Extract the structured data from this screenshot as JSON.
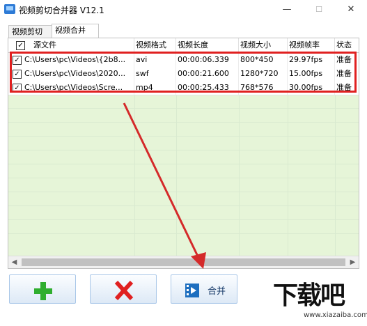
{
  "window": {
    "title": "视频剪切合并器 V12.1",
    "minimize": "—",
    "maximize": "☐",
    "close": "✕"
  },
  "tabs": [
    {
      "label": "视频剪切",
      "active": false
    },
    {
      "label": "视频合并",
      "active": true
    }
  ],
  "table": {
    "columns": [
      "源文件",
      "视频格式",
      "视频长度",
      "视频大小",
      "视频帧率",
      "状态"
    ],
    "rows": [
      {
        "checked": true,
        "file": "C:\\Users\\pc\\Videos\\{2b8...",
        "format": "avi",
        "length": "00:00:06.339",
        "size": "800*450",
        "fps": "29.97fps",
        "status": "准备"
      },
      {
        "checked": true,
        "file": "C:\\Users\\pc\\Videos\\2020...",
        "format": "swf",
        "length": "00:00:21.600",
        "size": "1280*720",
        "fps": "15.00fps",
        "status": "准备"
      },
      {
        "checked": true,
        "file": "C:\\Users\\pc\\Videos\\Scre...",
        "format": "mp4",
        "length": "00:00:25.433",
        "size": "768*576",
        "fps": "30.00fps",
        "status": "准备"
      }
    ]
  },
  "buttons": {
    "add_icon": "plus-icon",
    "delete_icon": "red-x-icon",
    "merge_label": "合并",
    "merge_icon": "film-icon"
  },
  "watermark": {
    "text": "下载吧",
    "url": "www.xiazaiba.com"
  },
  "colors": {
    "highlight_border": "#e02020",
    "arrow": "#d42a2a",
    "list_background": "#e6f5d8"
  }
}
